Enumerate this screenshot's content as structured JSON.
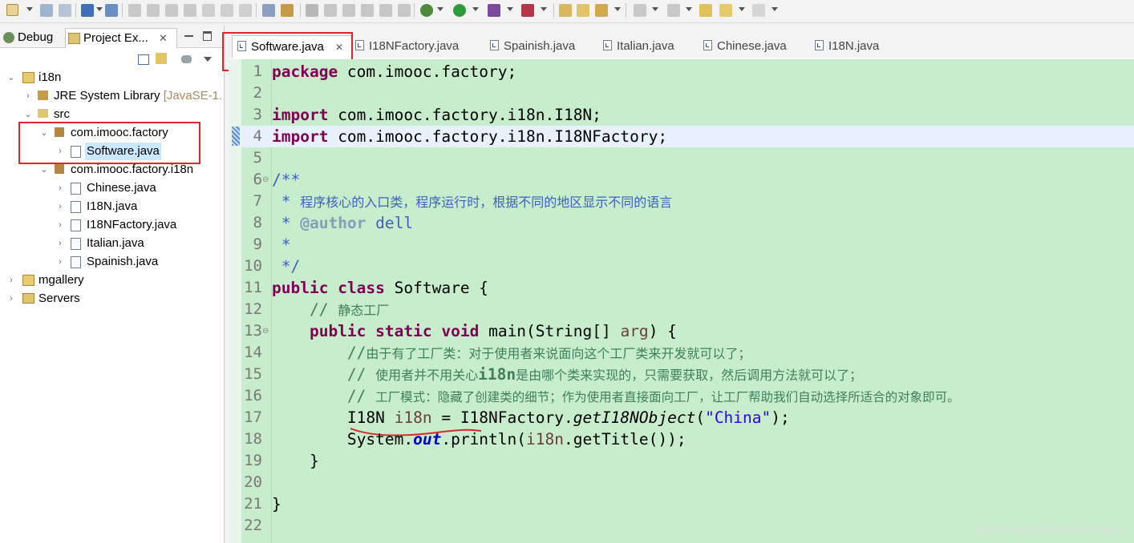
{
  "left_tabs": {
    "debug": "Debug",
    "project_explorer": "Project Ex..."
  },
  "tree": {
    "project": "i18n",
    "jre_library": "JRE System Library",
    "jre_decoration": "[JavaSE-1.",
    "src": "src",
    "package_factory": "com.imooc.factory",
    "software": "Software.java",
    "package_i18n": "com.imooc.factory.i18n",
    "chinese": "Chinese.java",
    "i18n_iface": "I18N.java",
    "i18n_factory": "I18NFactory.java",
    "italian": "Italian.java",
    "spainish": "Spainish.java",
    "mgallery": "mgallery",
    "servers": "Servers"
  },
  "editor_tabs": [
    {
      "label": "Software.java",
      "active": true
    },
    {
      "label": "I18NFactory.java"
    },
    {
      "label": "Spainish.java"
    },
    {
      "label": "Italian.java"
    },
    {
      "label": "Chinese.java"
    },
    {
      "label": "I18N.java"
    }
  ],
  "code": {
    "line_numbers": [
      "1",
      "2",
      "3",
      "4",
      "5",
      "6",
      "7",
      "8",
      "9",
      "10",
      "11",
      "12",
      "13",
      "14",
      "15",
      "16",
      "17",
      "18",
      "19",
      "20",
      "21",
      "22"
    ],
    "l1_kw": "package",
    "l1_rest": " com.imooc.factory;",
    "l3_kw": "import",
    "l3_rest": " com.imooc.factory.i18n.I18N;",
    "l4_kw": "import",
    "l4_rest": " com.imooc.factory.i18n.I18NFactory;",
    "l6": "/**",
    "l7_star": " * ",
    "l7_text": "程序核心的入口类，程序运行时，根据不同的地区显示不同的语言",
    "l8_star": " * ",
    "l8_tag": "@author",
    "l8_rest": " dell",
    "l9": " *",
    "l10": " */",
    "l11_kw1": "public",
    "l11_kw2": "class",
    "l11_rest": " Software {",
    "l12_prefix": "    // ",
    "l12_text": "静态工厂",
    "l13_kw1": "public",
    "l13_kw2": "static",
    "l13_kw3": "void",
    "l13_rest": " main(String[] ",
    "l13_arg": "arg",
    "l13_end": ") {",
    "l14_prefix": "        //",
    "l14_text": "由于有了工厂类：对于使用者来说面向这个工厂类来开发就可以了；",
    "l15_prefix": "        // ",
    "l15_text1": "使用者并不用关心",
    "l15_code": "i18n",
    "l15_text2": "是由哪个类来实现的，只需要获取，然后调用方法就可以了；",
    "l16_prefix": "        // ",
    "l16_text": "工厂模式：隐藏了创建类的细节；作为使用者直接面向工厂，让工厂帮助我们自动选择所适合的对象即可。",
    "l17_type": "        I18N ",
    "l17_var": "i18n",
    "l17_mid": " = I18NFactory.",
    "l17_method": "getI18NObject",
    "l17_open": "(",
    "l17_str": "\"China\"",
    "l17_close": ");",
    "l18_a": "        System.",
    "l18_field": "out",
    "l18_b": ".println(",
    "l18_var": "i18n",
    "l18_c": ".getTitle());",
    "l19": "    }",
    "l21": "}"
  },
  "watermark": "https://blog.csdn.net/csucsgoat",
  "colors": {
    "editor_bg": "#c7edcc",
    "annotation_red": "#e0262a",
    "keyword": "#7f0055",
    "javadoc": "#3f5fbf",
    "comment": "#3f7f5f",
    "string": "#2a00ff"
  }
}
